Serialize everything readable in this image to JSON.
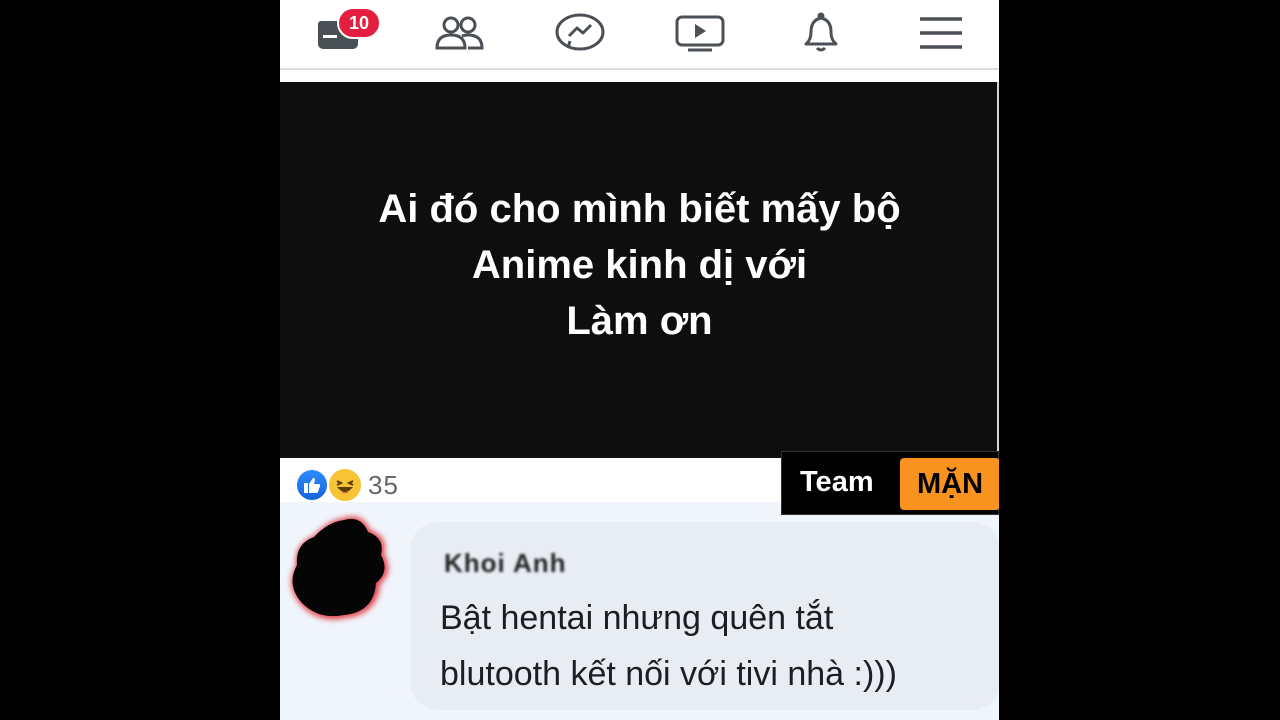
{
  "nav": {
    "items": [
      {
        "name": "home-icon",
        "badge": "10"
      },
      {
        "name": "friends-icon"
      },
      {
        "name": "messenger-icon"
      },
      {
        "name": "watch-icon"
      },
      {
        "name": "notifications-icon"
      },
      {
        "name": "menu-icon"
      }
    ],
    "badge_color": "#e41e3f"
  },
  "post": {
    "lines": [
      "Ai đó cho mình biết mấy bộ",
      "Anime kinh dị với",
      "Làm ơn"
    ],
    "background": "#0e0e0e"
  },
  "reactions": {
    "icons": [
      "like-icon",
      "haha-icon"
    ],
    "count": "35"
  },
  "watermark": {
    "label": "Team",
    "brand": "MẶN",
    "brand_color": "#f7931e"
  },
  "comment": {
    "author": "Khoi Anh",
    "lines": [
      "Bật hentai nhưng quên tắt",
      "blutooth kết nối với tivi nhà :)))"
    ]
  }
}
